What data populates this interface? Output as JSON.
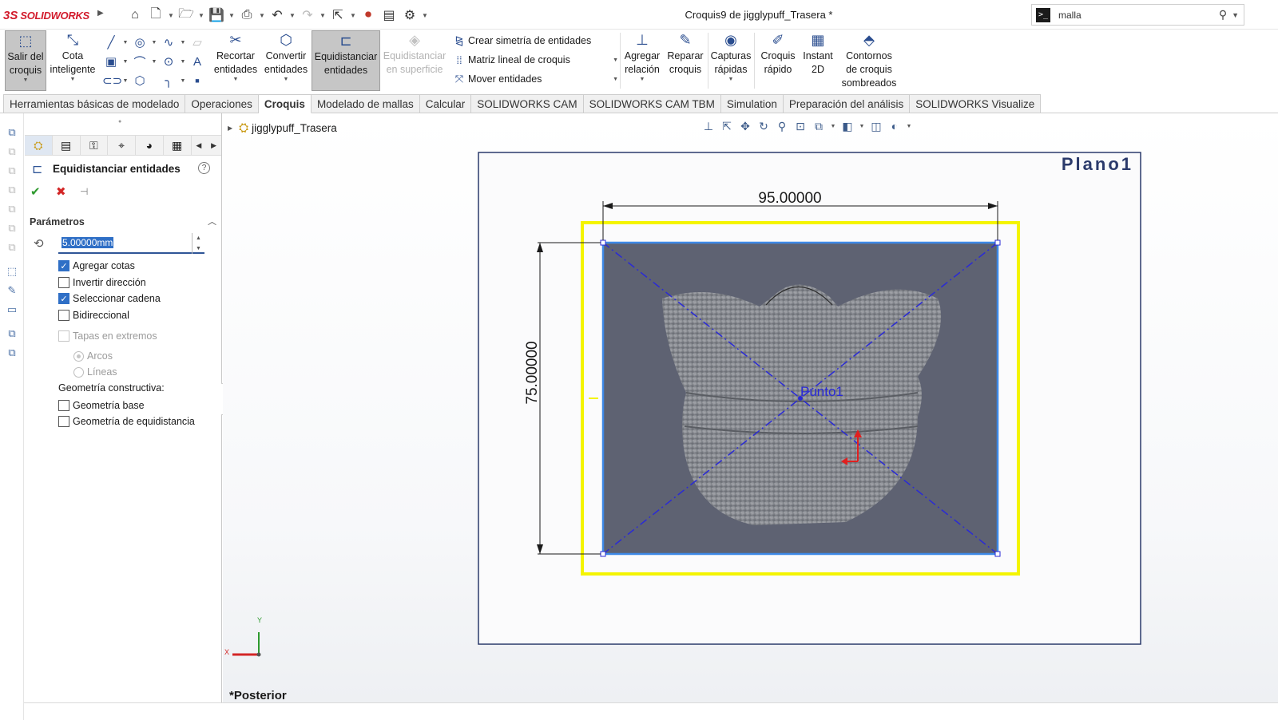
{
  "app": {
    "brand_prefix": "3S",
    "brand": "SOLIDWORKS"
  },
  "title_bar": {
    "document_title": "Croquis9 de jigglypuff_Trasera *"
  },
  "search": {
    "value": "malla",
    "prompt_symbol": ">_"
  },
  "ribbon": {
    "exit_sketch": [
      "Salir del",
      "croquis"
    ],
    "smart_dimension": [
      "Cota",
      "inteligente"
    ],
    "trim": [
      "Recortar",
      "entidades"
    ],
    "convert": [
      "Convertir",
      "entidades"
    ],
    "offset": [
      "Equidistanciar",
      "entidades"
    ],
    "offset_surface": [
      "Equidistanciar",
      "en superficie"
    ],
    "mirror": "Crear simetría de entidades",
    "linear_pattern": "Matriz lineal de croquis",
    "move": "Mover entidades",
    "add_relation": [
      "Agregar",
      "relación"
    ],
    "repair": [
      "Reparar",
      "croquis"
    ],
    "quick_snaps": [
      "Capturas",
      "rápidas"
    ],
    "rapid_sketch": [
      "Croquis",
      "rápido"
    ],
    "instant2d": [
      "Instant",
      "2D"
    ],
    "shaded_contours": [
      "Contornos",
      "de croquis",
      "sombreados"
    ]
  },
  "tabs": [
    "Herramientas básicas de modelado",
    "Operaciones",
    "Croquis",
    "Modelado de mallas",
    "Calcular",
    "SOLIDWORKS CAM",
    "SOLIDWORKS CAM TBM",
    "Simulation",
    "Preparación del análisis",
    "SOLIDWORKS Visualize"
  ],
  "active_tab": "Croquis",
  "property_manager": {
    "title": "Equidistanciar entidades",
    "section": "Parámetros",
    "distance_value": "5.00000mm",
    "options": {
      "add_dims": {
        "label": "Agregar cotas",
        "checked": true
      },
      "reverse": {
        "label": "Invertir dirección",
        "checked": false
      },
      "select_chain": {
        "label": "Seleccionar cadena",
        "checked": true
      },
      "bidirectional": {
        "label": "Bidireccional",
        "checked": false
      },
      "caps": {
        "label": "Tapas en extremos",
        "checked": false
      },
      "arcs": {
        "label": "Arcos",
        "selected": true
      },
      "lines": {
        "label": "Líneas",
        "selected": false
      },
      "construction_label": "Geometría constructiva:",
      "base_geom": {
        "label": "Geometría base",
        "checked": false
      },
      "offset_geom": {
        "label": "Geometría de equidistancia",
        "checked": false
      }
    }
  },
  "graphics": {
    "tree_root": "jigglypuff_Trasera",
    "plane_label": "Plano1",
    "dim_horizontal": "95.00000",
    "dim_vertical": "75.00000",
    "point_label": "Punto1",
    "axis_x": "X",
    "axis_y": "Y",
    "view_name": "*Posterior"
  },
  "colors": {
    "brand_red": "#d21b2c",
    "active_button": "#c6c6c6",
    "sketch_blue": "#2a2ad6",
    "offset_yellow": "#f4f400",
    "plane_border": "#2b3a6b"
  }
}
